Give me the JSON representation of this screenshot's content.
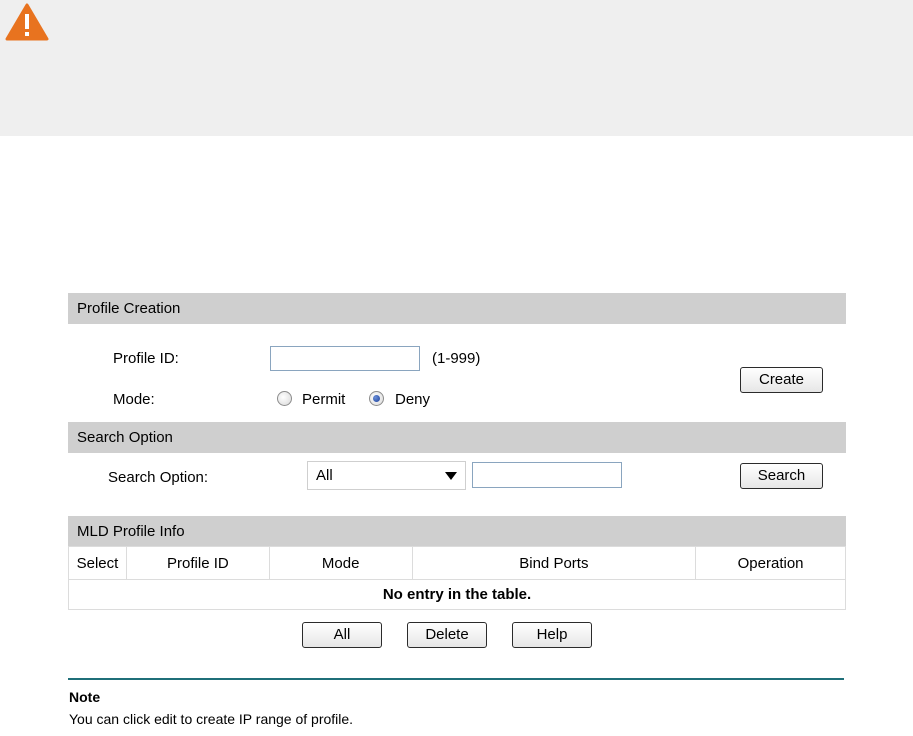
{
  "warning": {
    "icon": "warning-icon",
    "color": "#e8731f"
  },
  "profile_creation": {
    "header": "Profile Creation",
    "profile_id_label": "Profile ID:",
    "profile_id_value": "",
    "profile_id_range": "(1-999)",
    "mode_label": "Mode:",
    "mode_options": [
      "Permit",
      "Deny"
    ],
    "mode_selected": "Deny",
    "create_button": "Create"
  },
  "search_option": {
    "header": "Search Option",
    "label": "Search Option:",
    "select_value": "All",
    "search_value": "",
    "search_button": "Search"
  },
  "profile_info": {
    "header": "MLD Profile Info",
    "columns": [
      "Select",
      "Profile ID",
      "Mode",
      "Bind Ports",
      "Operation"
    ],
    "empty_message": "No entry in the table."
  },
  "buttons": {
    "all": "All",
    "delete": "Delete",
    "help": "Help"
  },
  "note": {
    "title": "Note",
    "text": "You can click edit to create IP range of profile."
  },
  "colors": {
    "section_header": "#cfcfcf",
    "banner": "#efefef",
    "note_rule": "#1f6f79"
  }
}
